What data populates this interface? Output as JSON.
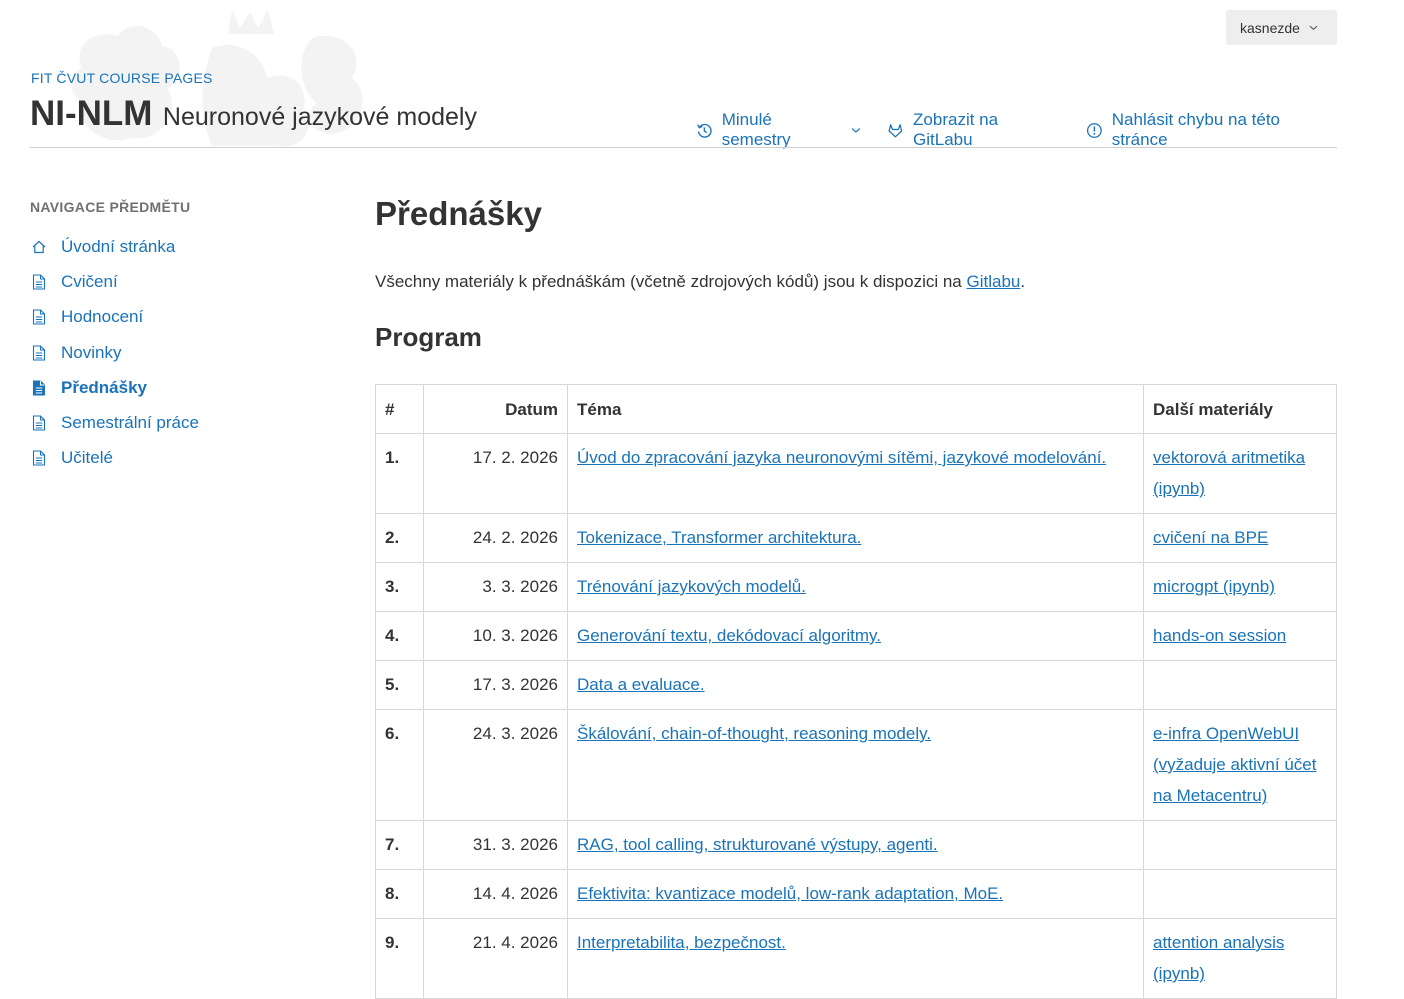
{
  "header": {
    "user_button": "kasnezde",
    "course_pages": "FIT ČVUT COURSE PAGES",
    "course_code": "NI-NLM",
    "course_name": "Neuronové jazykové modely",
    "links": [
      {
        "label": "Minulé semestry",
        "icon": "history-icon",
        "has_dropdown": true
      },
      {
        "label": "Zobrazit na GitLabu",
        "icon": "gitlab-icon"
      },
      {
        "label": "Nahlásit chybu na této stránce",
        "icon": "alert-icon"
      }
    ]
  },
  "sidebar": {
    "heading": "NAVIGACE PŘEDMĚTU",
    "items": [
      {
        "label": "Úvodní stránka",
        "icon": "home-icon"
      },
      {
        "label": "Cvičení",
        "icon": "document-icon"
      },
      {
        "label": "Hodnocení",
        "icon": "document-icon"
      },
      {
        "label": "Novinky",
        "icon": "document-icon"
      },
      {
        "label": "Přednášky",
        "icon": "document-icon",
        "active": true
      },
      {
        "label": "Semestrální práce",
        "icon": "document-icon"
      },
      {
        "label": "Učitelé",
        "icon": "document-icon"
      }
    ]
  },
  "main": {
    "title": "Přednášky",
    "intro_text": "Všechny materiály k přednáškám (včetně zdrojových kódů) jsou k dispozici na ",
    "intro_link": "Gitlabu",
    "intro_end": ".",
    "section_title": "Program",
    "table": {
      "headers": [
        "#",
        "Datum",
        "Téma",
        "Další materiály"
      ],
      "rows": [
        {
          "num": "1.",
          "date": "17. 2. 2026",
          "topic": "Úvod do zpracování jazyka neuronovými sítěmi, jazykové modelování.",
          "more": "vektorová aritmetika (ipynb)"
        },
        {
          "num": "2.",
          "date": "24. 2. 2026",
          "topic": "Tokenizace, Transformer architektura.",
          "more": "cvičení na BPE"
        },
        {
          "num": "3.",
          "date": "3. 3. 2026",
          "topic": "Trénování jazykových modelů.",
          "more": "microgpt (ipynb)"
        },
        {
          "num": "4.",
          "date": "10. 3. 2026",
          "topic": "Generování textu, dekódovací algoritmy.",
          "more": "hands-on session"
        },
        {
          "num": "5.",
          "date": "17. 3. 2026",
          "topic": "Data a evaluace.",
          "more": ""
        },
        {
          "num": "6.",
          "date": "24. 3. 2026",
          "topic": "Škálování, chain-of-thought, reasoning modely.",
          "more": "e-infra OpenWebUI (vyžaduje aktivní účet na Metacentru)"
        },
        {
          "num": "7.",
          "date": "31. 3. 2026",
          "topic": "RAG, tool calling, strukturované výstupy, agenti.",
          "more": ""
        },
        {
          "num": "8.",
          "date": "14. 4. 2026",
          "topic": "Efektivita: kvantizace modelů, low-rank adaptation, MoE.",
          "more": ""
        },
        {
          "num": "9.",
          "date": "21. 4. 2026",
          "topic": "Interpretabilita, bezpečnost.",
          "more": "attention analysis (ipynb)"
        }
      ]
    }
  },
  "colors": {
    "link": "#1a73b8",
    "text": "#333333",
    "muted": "#707070",
    "border": "#d8d8d8",
    "user_button_bg": "#eeeeee"
  }
}
